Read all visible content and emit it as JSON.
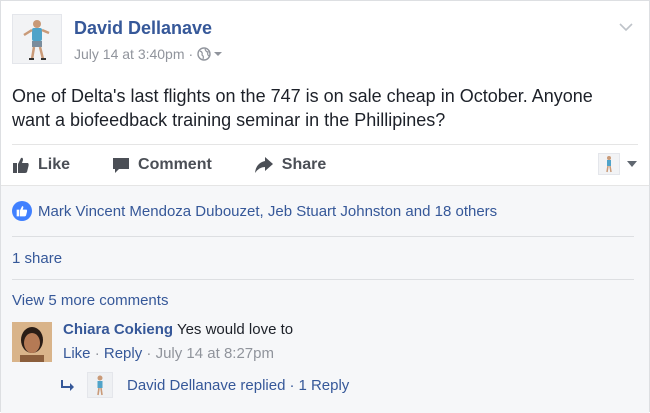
{
  "post": {
    "author": "David Dellanave",
    "timestamp": "July 14 at 3:40pm",
    "separator": "·",
    "privacy_icon": "globe-icon",
    "text": "One of Delta's last flights on the 747 is on sale cheap in October. Anyone want a biofeedback training seminar in the Phillipines?"
  },
  "actions": {
    "like": "Like",
    "comment": "Comment",
    "share": "Share"
  },
  "reactions": {
    "summary": "Mark Vincent Mendoza Dubouzet, Jeb Stuart Johnston and 18 others"
  },
  "shares": "1 share",
  "view_more": "View 5 more comments",
  "comment": {
    "author": "Chiara Cokieng",
    "text": "Yes would love to",
    "like": "Like",
    "reply": "Reply",
    "time": "July 14 at 8:27pm",
    "dot": "·"
  },
  "reply_summary": {
    "text": "David Dellanave replied",
    "count": "1 Reply",
    "dot": "·"
  },
  "colors": {
    "link": "#365899",
    "muted": "#90949c",
    "like_blue": "#4080ff"
  }
}
